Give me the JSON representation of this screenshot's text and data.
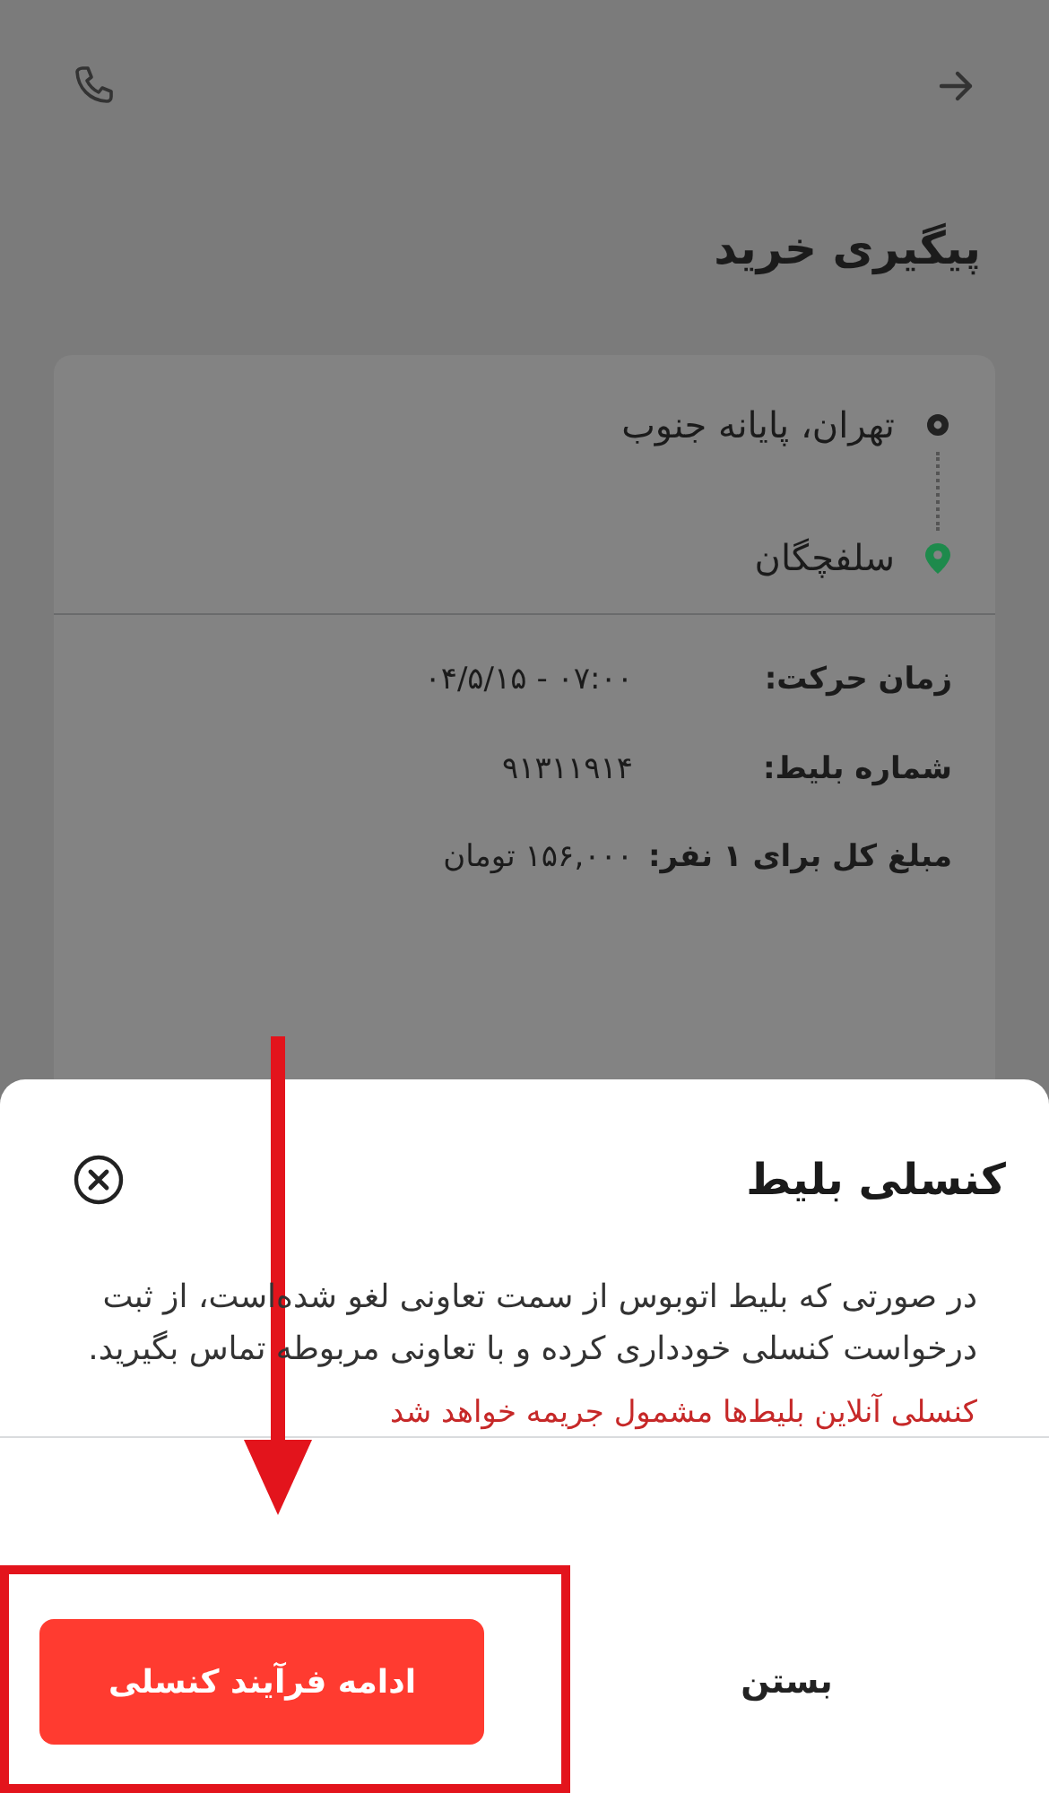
{
  "header": {
    "title": "پیگیری خرید"
  },
  "route": {
    "stops": [
      {
        "name": "تهران، پایانه جنوب",
        "kind": "origin"
      },
      {
        "name": "سلفچگان",
        "kind": "destination"
      }
    ]
  },
  "details": [
    {
      "label": "زمان حرکت:",
      "value": "۰۴/۵/۱۵ - ۰۷:۰۰"
    },
    {
      "label": "شماره بلیط:",
      "value": "۹۱۳۱۱۹۱۴"
    },
    {
      "label": "مبلغ کل برای ۱ نفر:",
      "value": "۱۵۶,۰۰۰ تومان"
    }
  ],
  "sheet": {
    "title": "کنسلی بلیط",
    "body": "در صورتی که بلیط اتوبوس از سمت تعاونی لغو شده‌است، از ثبت درخواست کنسلی خودداری کرده و با تعاونی مربوطه تماس بگیرید.",
    "warning": "کنسلی آنلاین بلیط‌ها مشمول جریمه خواهد شد",
    "buttons": [
      {
        "label": "بستن",
        "kind": "text"
      },
      {
        "label": "ادامه فرآیند کنسلی",
        "kind": "primary"
      }
    ]
  }
}
